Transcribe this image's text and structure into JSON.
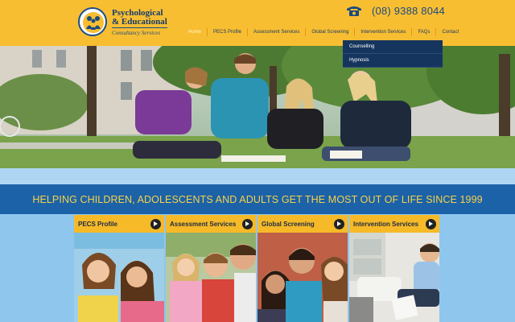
{
  "header": {
    "logo": {
      "line1": "Psychological",
      "line2": "& Educational",
      "line3": "Consultancy Services"
    },
    "phone": "(08) 9388 8044"
  },
  "nav": {
    "items": [
      "Home",
      "PECS Profile",
      "Assessment Services",
      "Global Screening",
      "Intervention Services",
      "FAQs",
      "Contact"
    ]
  },
  "dropdown": {
    "items": [
      "Counselling",
      "Hypnosis"
    ]
  },
  "tagline": "HELPING CHILDREN, ADOLESCENTS AND ADULTS GET THE MOST OUT OF LIFE SINCE 1999",
  "cards": [
    {
      "title": "PECS Profile"
    },
    {
      "title": "Assessment Services"
    },
    {
      "title": "Global Screening"
    },
    {
      "title": "Intervention Services"
    }
  ],
  "colors": {
    "header": "#f8be32",
    "nav_dropdown": "#16355e",
    "tagline_bar": "#1c62a8",
    "tagline_text": "#f6d24a",
    "card_head": "#f6b928",
    "page_bg": "#8fc6ee"
  }
}
